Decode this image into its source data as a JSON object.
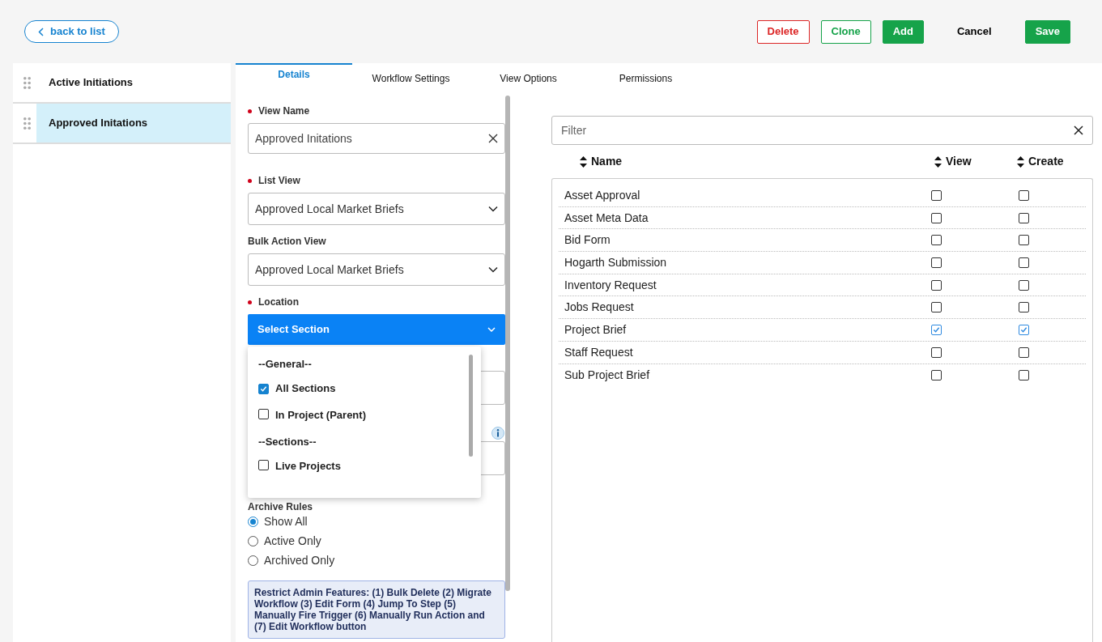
{
  "header": {
    "back_button": "back to list",
    "actions": [
      {
        "label": "Delete",
        "kind": "danger"
      },
      {
        "label": "Clone",
        "kind": "outline"
      },
      {
        "label": "Add",
        "kind": "primary"
      },
      {
        "label": "Cancel",
        "kind": "plain"
      },
      {
        "label": "Save",
        "kind": "primary"
      }
    ]
  },
  "sidebar": {
    "items": [
      {
        "label": "Active Initiations",
        "selected": false
      },
      {
        "label": "Approved Initations",
        "selected": true
      }
    ]
  },
  "tabs": [
    {
      "label": "Details",
      "selected": true
    },
    {
      "label": "Workflow Settings",
      "selected": false
    },
    {
      "label": "View Options",
      "selected": false
    },
    {
      "label": "Permissions",
      "selected": false
    }
  ],
  "form": {
    "view_name": {
      "label": "View Name",
      "required": true,
      "value": "Approved Initations"
    },
    "list_view": {
      "label": "List View",
      "required": true,
      "value": "Approved Local Market Briefs"
    },
    "bulk_action_view": {
      "label": "Bulk Action View",
      "value": "Approved Local Market Briefs"
    },
    "location": {
      "label": "Location",
      "required": true,
      "value": "Select Section",
      "expanded": true,
      "options": [
        {
          "kind": "group",
          "label": "--General--"
        },
        {
          "kind": "option",
          "label": "All Sections",
          "checked": true
        },
        {
          "kind": "option",
          "label": "In Project (Parent)",
          "checked": false
        },
        {
          "kind": "group",
          "label": "--Sections--"
        },
        {
          "kind": "option",
          "label": "Live Projects",
          "checked": false
        }
      ]
    },
    "archive_rules": {
      "label": "Archive Rules",
      "options": [
        {
          "label": "Show All",
          "selected": true
        },
        {
          "label": "Active Only",
          "selected": false
        },
        {
          "label": "Archived Only",
          "selected": false
        }
      ]
    },
    "notice": "Restrict Admin Features: (1) Bulk Delete (2) Migrate Workflow (3) Edit Form (4) Jump To Step (5) Manually Fire Trigger (6) Manually Run Action and (7) Edit Workflow button"
  },
  "permissions": {
    "filter": {
      "placeholder": "Filter"
    },
    "columns": [
      "Name",
      "View",
      "Create"
    ],
    "rows": [
      {
        "name": "Asset Approval",
        "view": false,
        "create": false
      },
      {
        "name": "Asset Meta Data",
        "view": false,
        "create": false
      },
      {
        "name": "Bid Form",
        "view": false,
        "create": false
      },
      {
        "name": "Hogarth Submission",
        "view": false,
        "create": false
      },
      {
        "name": "Inventory Request",
        "view": false,
        "create": false
      },
      {
        "name": "Jobs Request",
        "view": false,
        "create": false
      },
      {
        "name": "Project Brief",
        "view": true,
        "create": true
      },
      {
        "name": "Staff Request",
        "view": false,
        "create": false
      },
      {
        "name": "Sub Project Brief",
        "view": false,
        "create": false
      }
    ]
  }
}
